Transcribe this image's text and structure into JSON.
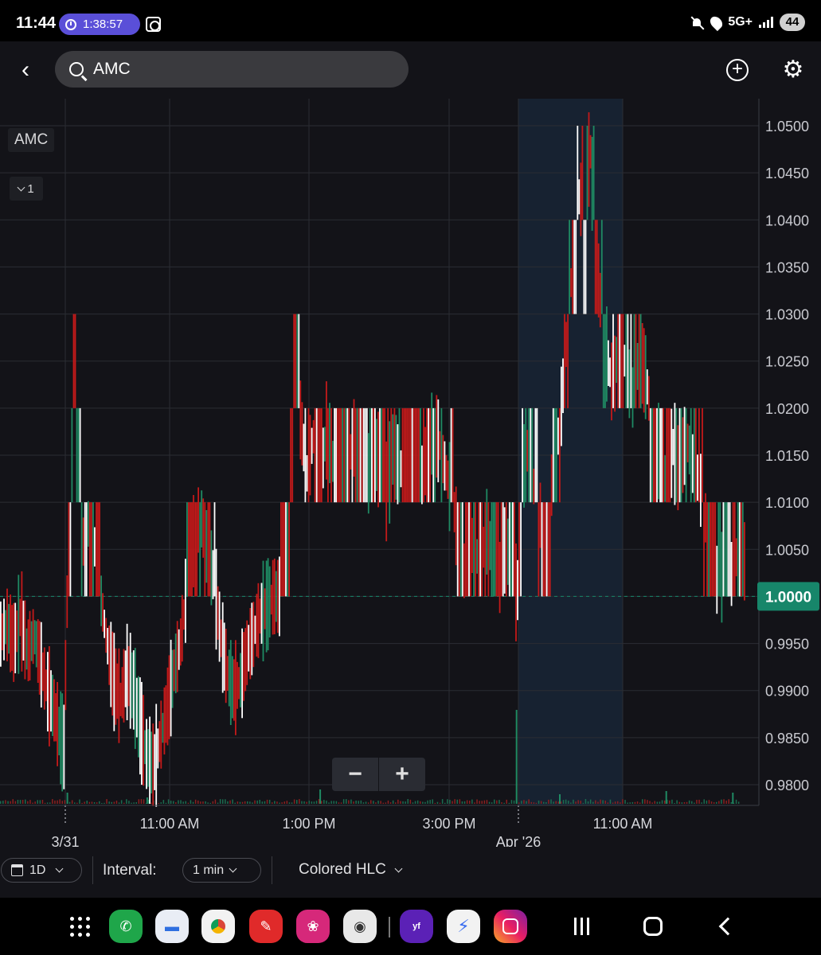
{
  "status_bar": {
    "time": "11:44",
    "timer": "1:38:57",
    "network": "5G+",
    "battery": "44"
  },
  "app_bar": {
    "search_text": "AMC"
  },
  "chart": {
    "symbol_label": "AMC",
    "study_count": "1",
    "current_price_label": "1.0000",
    "y_ticks": [
      "1.0500",
      "1.0450",
      "1.0400",
      "1.0350",
      "1.0300",
      "1.0250",
      "1.0200",
      "1.0150",
      "1.0100",
      "1.0050",
      "1.0000",
      "0.9950",
      "0.9900",
      "0.9850",
      "0.9800"
    ],
    "x_time_labels": [
      "11:00 AM",
      "1:00 PM",
      "3:00 PM",
      "11:00 AM"
    ],
    "x_date_labels": [
      "3/31",
      "Apr '26"
    ],
    "colors": {
      "background": "#131318",
      "up": "#1f8a63",
      "down": "#c41a1a",
      "neutral": "#ffffff",
      "price_tag": "#17866a",
      "session_shade": "#172231"
    }
  },
  "chart_data": {
    "type": "line",
    "style": "Colored HLC",
    "ylim": [
      0.98,
      1.0525
    ],
    "current_price": 1.0,
    "price_path": [
      [
        0,
        0.996
      ],
      [
        2,
        0.997
      ],
      [
        4,
        0.995
      ],
      [
        6,
        0.998
      ],
      [
        8,
        0.994
      ],
      [
        10,
        0.996
      ],
      [
        12,
        0.993
      ],
      [
        14,
        0.99
      ],
      [
        16,
        0.988
      ],
      [
        18,
        0.985
      ],
      [
        19,
        0.984
      ],
      [
        20,
        1.0
      ],
      [
        21,
        1.01
      ],
      [
        22,
        1.028
      ],
      [
        23,
        1.018
      ],
      [
        24,
        1.01
      ],
      [
        25,
        1.005
      ],
      [
        26,
        1.008
      ],
      [
        28,
        1.006
      ],
      [
        30,
        1.0
      ],
      [
        32,
        0.995
      ],
      [
        34,
        0.991
      ],
      [
        36,
        0.989
      ],
      [
        38,
        0.992
      ],
      [
        40,
        0.99
      ],
      [
        42,
        0.986
      ],
      [
        44,
        0.983
      ],
      [
        46,
        0.982
      ],
      [
        48,
        0.985
      ],
      [
        50,
        0.988
      ],
      [
        52,
        0.992
      ],
      [
        54,
        0.995
      ],
      [
        56,
        1.001
      ],
      [
        58,
        1.006
      ],
      [
        60,
        1.009
      ],
      [
        62,
        1.005
      ],
      [
        64,
        1.002
      ],
      [
        66,
        0.996
      ],
      [
        68,
        0.992
      ],
      [
        70,
        0.99
      ],
      [
        72,
        0.991
      ],
      [
        74,
        0.994
      ],
      [
        76,
        0.996
      ],
      [
        78,
        0.998
      ],
      [
        80,
        0.999
      ],
      [
        82,
        1.0
      ],
      [
        84,
        1.0
      ],
      [
        86,
        1.001
      ],
      [
        87,
        1.01
      ],
      [
        88,
        1.025
      ],
      [
        90,
        1.019
      ],
      [
        92,
        1.013
      ],
      [
        94,
        1.017
      ],
      [
        96,
        1.012
      ],
      [
        98,
        1.018
      ],
      [
        100,
        1.014
      ],
      [
        102,
        1.016
      ],
      [
        104,
        1.013
      ],
      [
        106,
        1.017
      ],
      [
        108,
        1.015
      ],
      [
        110,
        1.012
      ],
      [
        112,
        1.016
      ],
      [
        114,
        1.014
      ],
      [
        116,
        1.011
      ],
      [
        118,
        1.016
      ],
      [
        120,
        1.013
      ],
      [
        122,
        1.017
      ],
      [
        124,
        1.014
      ],
      [
        126,
        1.012
      ],
      [
        128,
        1.015
      ],
      [
        130,
        1.018
      ],
      [
        132,
        1.016
      ],
      [
        134,
        1.013
      ],
      [
        136,
        1.01
      ],
      [
        138,
        1.004
      ],
      [
        140,
        1.002
      ],
      [
        142,
        1.006
      ],
      [
        144,
        1.003
      ],
      [
        146,
        1.007
      ],
      [
        148,
        1.004
      ],
      [
        150,
        1.002
      ],
      [
        152,
        1.006
      ],
      [
        154,
        1.0
      ],
      [
        156,
        1.001
      ],
      [
        157,
        1.013
      ],
      [
        158,
        1.016
      ],
      [
        160,
        1.012
      ],
      [
        162,
        1.009
      ],
      [
        164,
        1.004
      ],
      [
        166,
        1.014
      ],
      [
        168,
        1.018
      ],
      [
        170,
        1.027
      ],
      [
        172,
        1.036
      ],
      [
        174,
        1.043
      ],
      [
        176,
        1.038
      ],
      [
        177,
        1.049
      ],
      [
        178,
        1.042
      ],
      [
        180,
        1.032
      ],
      [
        182,
        1.026
      ],
      [
        184,
        1.022
      ],
      [
        186,
        1.028
      ],
      [
        188,
        1.024
      ],
      [
        190,
        1.021
      ],
      [
        192,
        1.026
      ],
      [
        194,
        1.023
      ],
      [
        196,
        1.018
      ],
      [
        198,
        1.015
      ],
      [
        200,
        1.012
      ],
      [
        202,
        1.016
      ],
      [
        204,
        1.013
      ],
      [
        206,
        1.017
      ],
      [
        208,
        1.014
      ],
      [
        210,
        1.012
      ],
      [
        212,
        1.008
      ],
      [
        214,
        1.003
      ],
      [
        216,
        1.001
      ],
      [
        218,
        1.004
      ],
      [
        220,
        1.002
      ],
      [
        222,
        1.006
      ],
      [
        224,
        1.003
      ]
    ],
    "volume_spikes": [
      [
        20,
        14
      ],
      [
        44,
        8
      ],
      [
        96,
        18
      ],
      [
        155,
        118
      ],
      [
        168,
        12
      ],
      [
        200,
        16
      ],
      [
        220,
        14
      ]
    ]
  },
  "toolbar": {
    "range": "1D",
    "interval_label": "Interval:",
    "interval_value": "1 min",
    "chart_type": "Colored HLC"
  }
}
